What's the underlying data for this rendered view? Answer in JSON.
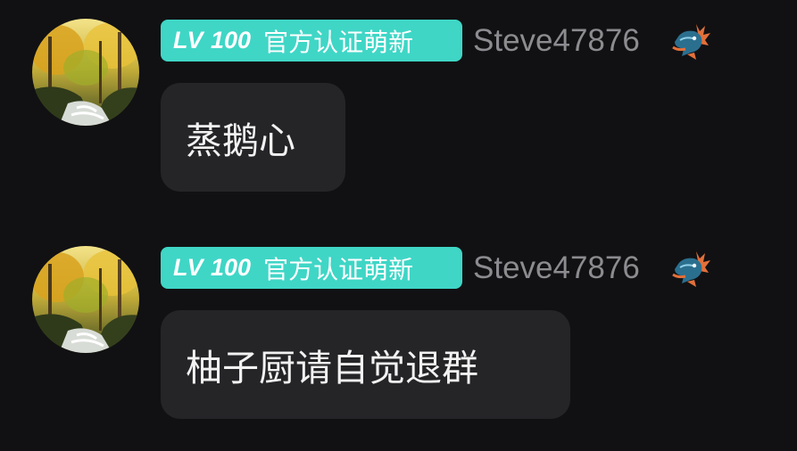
{
  "messages": [
    {
      "badge": {
        "level_prefix": "LV",
        "level_number": "100",
        "title": "官方认证萌新",
        "color": "#3fd6c6"
      },
      "username": "Steve47876",
      "avatar_icon": "waterfall-forest-avatar",
      "badge_icon": "dragon-icon",
      "text": "蒸鹅心"
    },
    {
      "badge": {
        "level_prefix": "LV",
        "level_number": "100",
        "title": "官方认证萌新",
        "color": "#3fd6c6"
      },
      "username": "Steve47876",
      "avatar_icon": "waterfall-forest-avatar",
      "badge_icon": "dragon-icon",
      "text": "柚子厨请自觉退群"
    }
  ],
  "colors": {
    "background": "#111113",
    "bubble": "#252528",
    "username": "#8c8c90",
    "message_text": "#f2f2f2"
  }
}
